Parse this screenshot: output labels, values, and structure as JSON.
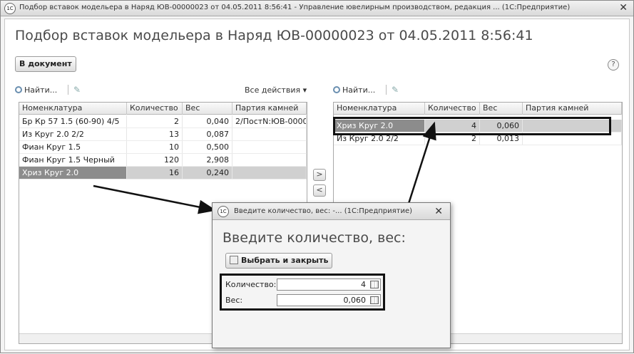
{
  "window": {
    "app_logo": "1С",
    "title": "Подбор вставок модельера в Наряд ЮВ-00000023 от 04.05.2011 8:56:41 - Управление ювелирным производством, редакция ... (1С:Предприятие)",
    "close": "✕"
  },
  "form": {
    "title": "Подбор вставок модельера в Наряд ЮВ-00000023 от 04.05.2011 8:56:41",
    "to_document_button": "В документ",
    "help": "?",
    "move_right": ">",
    "move_left": "<"
  },
  "left_panel": {
    "find_label": "Найти...",
    "all_actions_label": "Все действия ▾",
    "columns": [
      "Номенклатура",
      "Количество",
      "Вес",
      "Партия камней"
    ],
    "rows": [
      {
        "name": "Бр Кр 57 1.5 (60-90) 4/5",
        "qty": "2",
        "weight": "0,040",
        "batch": "2/ПостN:ЮВ-0000"
      },
      {
        "name": "Из Круг 2.0 2/2",
        "qty": "13",
        "weight": "0,087",
        "batch": ""
      },
      {
        "name": "Фиан Круг 1.5",
        "qty": "10",
        "weight": "0,500",
        "batch": ""
      },
      {
        "name": "Фиан Круг 1.5 Черный",
        "qty": "120",
        "weight": "2,908",
        "batch": ""
      },
      {
        "name": "Хриз Круг 2.0",
        "qty": "16",
        "weight": "0,240",
        "batch": ""
      }
    ],
    "selected_row": 4
  },
  "right_panel": {
    "find_label": "Найти...",
    "columns": [
      "Номенклатура",
      "Количество",
      "Вес",
      "Партия камней"
    ],
    "rows": [
      {
        "name": "Хриз Круг 2.0",
        "qty": "4",
        "weight": "0,060",
        "batch": ""
      },
      {
        "name": "Из Круг 2.0 2/2",
        "qty": "2",
        "weight": "0,013",
        "batch": ""
      }
    ],
    "selected_row": 0
  },
  "dialog": {
    "app_logo": "1С",
    "title": "Введите количество, вес: -... (1С:Предприятие)",
    "close": "✕",
    "header": "Введите количество, вес:",
    "select_close_button": "Выбрать и закрыть",
    "qty_label": "Количество:",
    "qty_value": "4",
    "weight_label": "Вес:",
    "weight_value": "0,060"
  },
  "colors": {
    "selection": "#8c8c8c",
    "annotation": "#111111"
  }
}
